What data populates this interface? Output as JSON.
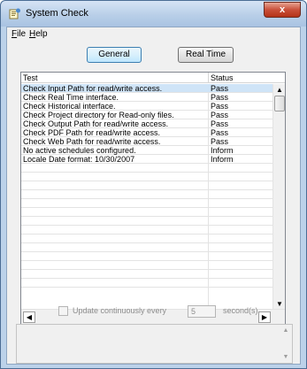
{
  "window": {
    "title": "System Check",
    "close_glyph": "x"
  },
  "menu": [
    {
      "accel": "F",
      "rest": "ile"
    },
    {
      "accel": "H",
      "rest": "elp"
    }
  ],
  "tabs": {
    "general_label": "General",
    "realtime_label": "Real Time"
  },
  "table": {
    "headers": {
      "test": "Test",
      "status": "Status"
    },
    "rows": [
      {
        "test": "Check Input Path for read/write access.",
        "status": "Pass"
      },
      {
        "test": "Check Real Time interface.",
        "status": "Pass"
      },
      {
        "test": "Check Historical interface.",
        "status": "Pass"
      },
      {
        "test": "Check Project directory for Read-only files.",
        "status": "Pass"
      },
      {
        "test": "Check Output Path for read/write access.",
        "status": "Pass"
      },
      {
        "test": "Check PDF Path for read/write access.",
        "status": "Pass"
      },
      {
        "test": "Check Web Path for read/write access.",
        "status": "Pass"
      },
      {
        "test": "No active schedules configured.",
        "status": "Inform"
      },
      {
        "test": "Locale Date format:  10/30/2007",
        "status": "Inform"
      },
      {
        "test": "",
        "status": ""
      },
      {
        "test": "",
        "status": ""
      },
      {
        "test": "",
        "status": ""
      },
      {
        "test": "",
        "status": ""
      },
      {
        "test": "",
        "status": ""
      },
      {
        "test": "",
        "status": ""
      },
      {
        "test": "",
        "status": ""
      },
      {
        "test": "",
        "status": ""
      },
      {
        "test": "",
        "status": ""
      },
      {
        "test": "",
        "status": ""
      },
      {
        "test": "",
        "status": ""
      },
      {
        "test": "",
        "status": ""
      },
      {
        "test": "",
        "status": ""
      },
      {
        "test": "",
        "status": ""
      }
    ],
    "selected_row": 0
  },
  "update": {
    "checkbox_label": "Update continuously every",
    "interval_value": "5",
    "unit_label": "second(s)",
    "checked": false
  },
  "colors": {
    "selection": "#cfe4f7",
    "title_bar": "#bcd2ea",
    "close_button": "#c9503a"
  },
  "icons": [
    "app-icon",
    "close-icon",
    "scroll-up-icon",
    "scroll-down-icon",
    "scroll-left-icon",
    "scroll-right-icon"
  ]
}
